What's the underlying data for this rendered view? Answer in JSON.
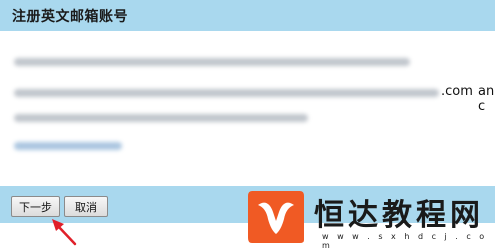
{
  "header": {
    "title": "注册英文邮箱账号"
  },
  "content": {
    "visible_fragments": [
      ".com",
      "and c"
    ]
  },
  "footer": {
    "next_label": "下一步",
    "cancel_label": "取消"
  },
  "watermark": {
    "name": "恒达教程网",
    "url": "w w w . s x h d c j . c o m",
    "logo_color": "#f05a24"
  },
  "colors": {
    "header_bg": "#a9d8ee",
    "annotation_arrow": "#e0202a"
  }
}
